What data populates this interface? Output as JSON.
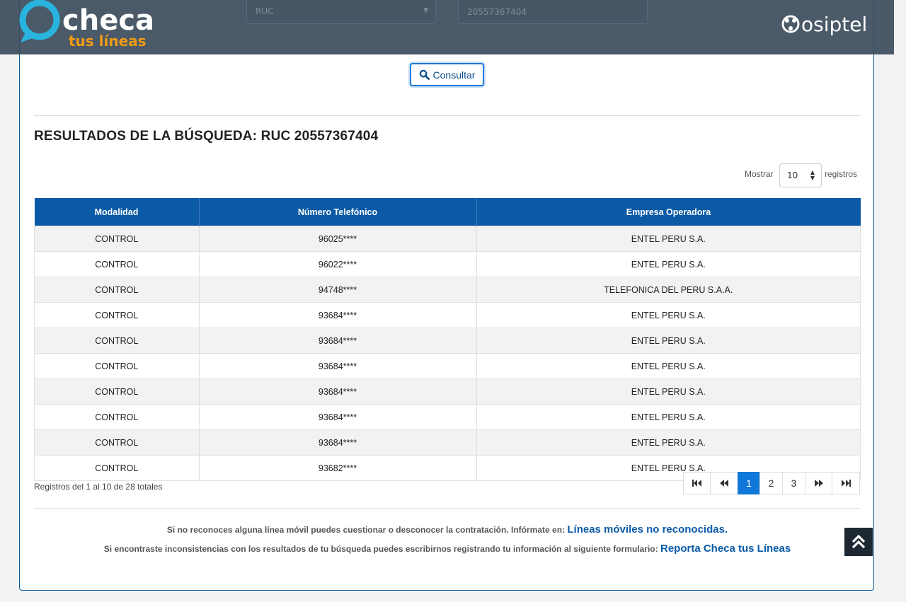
{
  "header": {
    "logo_primary": "checa",
    "logo_secondary": "tus líneas",
    "regulator_logo": "osiptel",
    "doc_type_value": "RUC",
    "doc_number_value": "20557367404"
  },
  "search": {
    "submit_label": "Consultar"
  },
  "results": {
    "title": "RESULTADOS DE LA BÚSQUEDA: RUC 20557367404",
    "show_label": "Mostrar",
    "records_label": "registros",
    "page_size": "10",
    "columns": [
      "Modalidad",
      "Número Telefónico",
      "Empresa Operadora"
    ],
    "rows": [
      [
        "CONTROL",
        "96025****",
        "ENTEL PERU S.A."
      ],
      [
        "CONTROL",
        "96022****",
        "ENTEL PERU S.A."
      ],
      [
        "CONTROL",
        "94748****",
        "TELEFONICA DEL PERU S.A.A."
      ],
      [
        "CONTROL",
        "93684****",
        "ENTEL PERU S.A."
      ],
      [
        "CONTROL",
        "93684****",
        "ENTEL PERU S.A."
      ],
      [
        "CONTROL",
        "93684****",
        "ENTEL PERU S.A."
      ],
      [
        "CONTROL",
        "93684****",
        "ENTEL PERU S.A."
      ],
      [
        "CONTROL",
        "93684****",
        "ENTEL PERU S.A."
      ],
      [
        "CONTROL",
        "93684****",
        "ENTEL PERU S.A."
      ],
      [
        "CONTROL",
        "93682****",
        "ENTEL PERU S.A."
      ]
    ],
    "summary": "Registros del 1 al 10 de 28 totales",
    "pages": [
      "1",
      "2",
      "3"
    ],
    "current_page": "1"
  },
  "footer": {
    "notice1_text": "Si no reconoces alguna línea móvil puedes cuestionar o desconocer la contratación. Infórmate en:",
    "notice1_link": "Líneas móviles no reconocidas.",
    "notice2_text": "Si encontraste inconsistencias con los resultados de tu búsqueda puedes escribirnos registrando tu información al siguiente formulario:",
    "notice2_link": "Reporta Checa tus Líneas"
  },
  "icons": {
    "search": "search-icon",
    "first": "first-page-icon",
    "prev": "prev-page-icon",
    "next": "next-page-icon",
    "last": "last-page-icon",
    "scroll_top": "double-chevron-up-icon"
  },
  "colors": {
    "header_bg": "#3c4c5c",
    "table_header": "#0b5aa6",
    "active_page": "#1078d8",
    "accent_cyan": "#29b4e0",
    "accent_orange": "#f39c12",
    "link": "#0a5aa8"
  }
}
